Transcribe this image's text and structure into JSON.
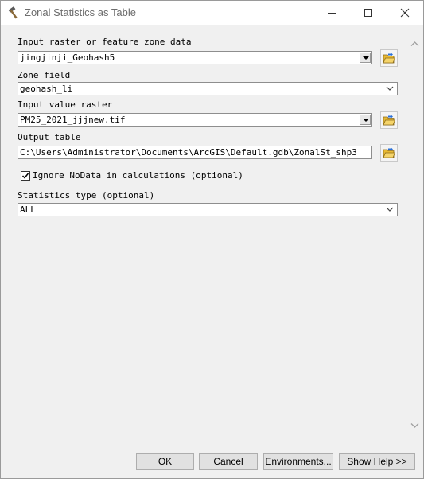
{
  "window": {
    "title": "Zonal Statistics as Table"
  },
  "fields": {
    "zone_data_label": "Input raster or feature zone data",
    "zone_data_value": "jingjinji_Geohash5",
    "zone_field_label": "Zone field",
    "zone_field_value": "geohash_li",
    "value_raster_label": "Input value raster",
    "value_raster_value": "PM25_2021_jjjnew.tif",
    "output_table_label": "Output table",
    "output_table_value": "C:\\Users\\Administrator\\Documents\\ArcGIS\\Default.gdb\\ZonalSt_shp3",
    "ignore_nodata_label": "Ignore NoData in calculations (optional)",
    "ignore_nodata_checked": true,
    "stats_type_label": "Statistics type (optional)",
    "stats_type_value": "ALL"
  },
  "buttons": {
    "ok": "OK",
    "cancel": "Cancel",
    "environments": "Environments...",
    "show_help": "Show Help >>"
  },
  "icons": {
    "title": "hammer-icon",
    "browse": "folder-open-icon",
    "minimize": "minimize-icon",
    "maximize": "maximize-icon",
    "close": "close-icon"
  },
  "colors": {
    "folder": "#e8b932",
    "arrow": "#2a6fd6"
  }
}
